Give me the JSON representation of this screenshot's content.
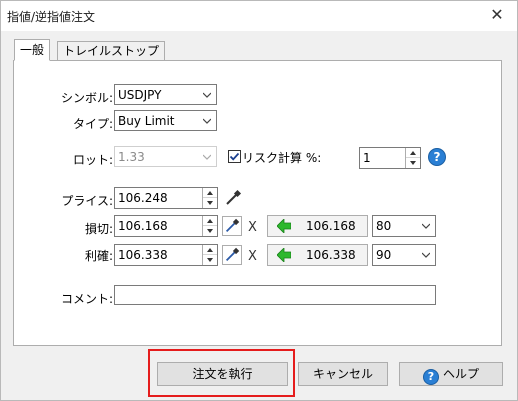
{
  "window": {
    "title": "指値/逆指値注文"
  },
  "tabs": [
    {
      "label": "一般"
    },
    {
      "label": "トレイルストップ"
    }
  ],
  "form": {
    "symbol_label": "シンボル:",
    "symbol_value": "USDJPY",
    "type_label": "タイプ:",
    "type_value": "Buy Limit",
    "lot_label": "ロット:",
    "lot_value": "1.33",
    "risk_checkbox_label": "リスク計算 %:",
    "risk_checked": true,
    "risk_value": "1",
    "price_label": "プライス:",
    "price_value": "106.248",
    "stoploss_label": "損切:",
    "stoploss_value": "106.168",
    "stoploss_target": "106.168",
    "stoploss_pips": "80",
    "takeprofit_label": "利確:",
    "takeprofit_value": "106.338",
    "takeprofit_target": "106.338",
    "takeprofit_pips": "90",
    "comment_label": "コメント:",
    "comment_value": "",
    "multiply_sign": "X"
  },
  "buttons": {
    "execute": "注文を執行",
    "cancel": "キャンセル",
    "help": "ヘルプ"
  },
  "colors": {
    "highlight": "#e51c1c",
    "accent_green": "#2db82d",
    "help_blue": "#2a7fd4"
  },
  "icons": {
    "close": "close-icon",
    "dropdown": "chevron-down-icon",
    "picker": "eyedropper-icon",
    "arrow": "green-left-arrow-icon",
    "help": "question-icon"
  }
}
